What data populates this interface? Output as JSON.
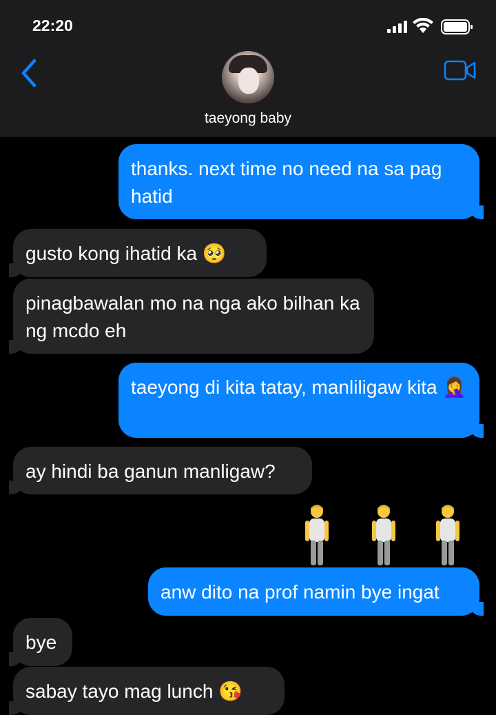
{
  "status_bar": {
    "time": "22:20"
  },
  "header": {
    "contact_name": "taeyong baby"
  },
  "messages": [
    {
      "side": "outgoing",
      "text": "thanks. next time no need na sa pag hatid"
    },
    {
      "side": "incoming",
      "text": "gusto kong ihatid ka 🥺"
    },
    {
      "side": "incoming",
      "text": "pinagbawalan mo na nga ako bilhan ka ng mcdo eh"
    },
    {
      "side": "outgoing",
      "text": "taeyong di kita tatay, manliligaw kita 🤦‍♀️"
    },
    {
      "side": "incoming",
      "text": "ay hindi ba ganun manligaw?"
    },
    {
      "side": "outgoing",
      "type": "emoji",
      "text": "🧍‍♂️ 🧍‍♂️ 🧍‍♂️"
    },
    {
      "side": "outgoing",
      "text": "anw dito na prof namin bye ingat"
    },
    {
      "side": "incoming",
      "text": "bye"
    },
    {
      "side": "incoming",
      "text": "sabay tayo mag lunch 😘"
    }
  ],
  "colors": {
    "outgoing": "#0a84ff",
    "incoming": "#262628",
    "accent": "#0a84ff"
  },
  "icons": [
    "back-chevron-icon",
    "video-camera-icon",
    "signal-icon",
    "wifi-icon",
    "battery-icon"
  ]
}
